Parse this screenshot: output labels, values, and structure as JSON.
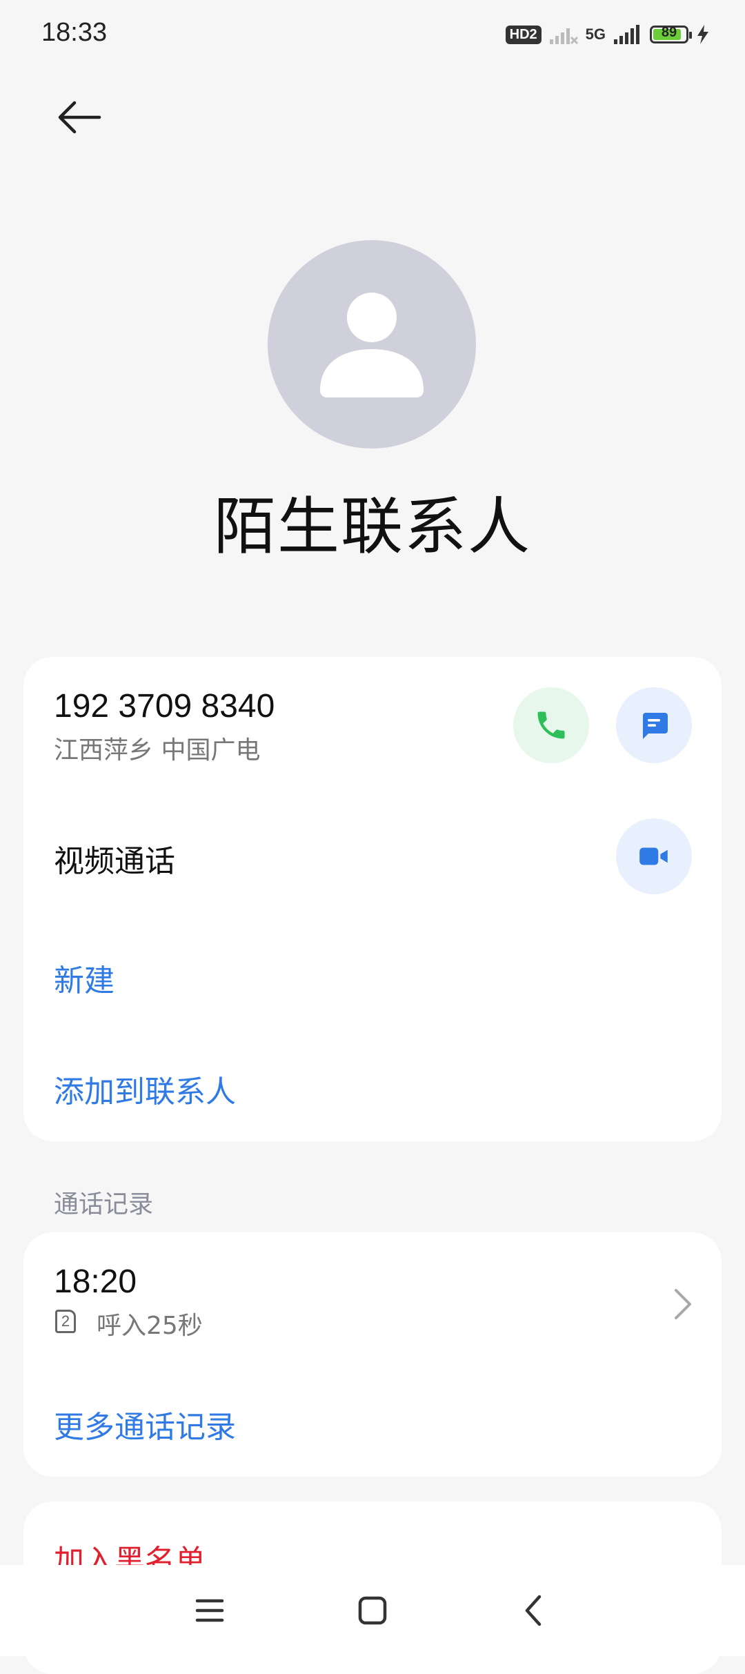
{
  "status_bar": {
    "time": "18:33",
    "hd_badge": "HD2",
    "network": "5G",
    "battery_level": 89,
    "battery_text": "89",
    "icons": [
      "signal-icon",
      "signal-full-icon",
      "battery-icon",
      "charging-icon"
    ]
  },
  "header": {
    "back_icon": "back-arrow-icon"
  },
  "contact": {
    "name": "陌生联系人",
    "avatar_icon": "person-icon"
  },
  "phone": {
    "number": "192 3709 8340",
    "location": "江西萍乡 中国广电",
    "call_icon": "phone-icon",
    "message_icon": "message-icon"
  },
  "actions": {
    "video_call": "视频通话",
    "video_icon": "video-camera-icon",
    "new": "新建",
    "add_to_contacts": "添加到联系人"
  },
  "call_log": {
    "section_title": "通话记录",
    "entries": [
      {
        "time": "18:20",
        "sim": "2",
        "detail": "呼入25秒"
      }
    ],
    "more": "更多通话记录"
  },
  "blacklist": {
    "label": "加入黑名单"
  },
  "colors": {
    "background": "#f6f6f6",
    "card": "#ffffff",
    "accent_blue": "#2f7ae5",
    "call_green": "#2fbf5a",
    "danger_red": "#e0202f",
    "avatar_gray": "#cfd0dc"
  }
}
